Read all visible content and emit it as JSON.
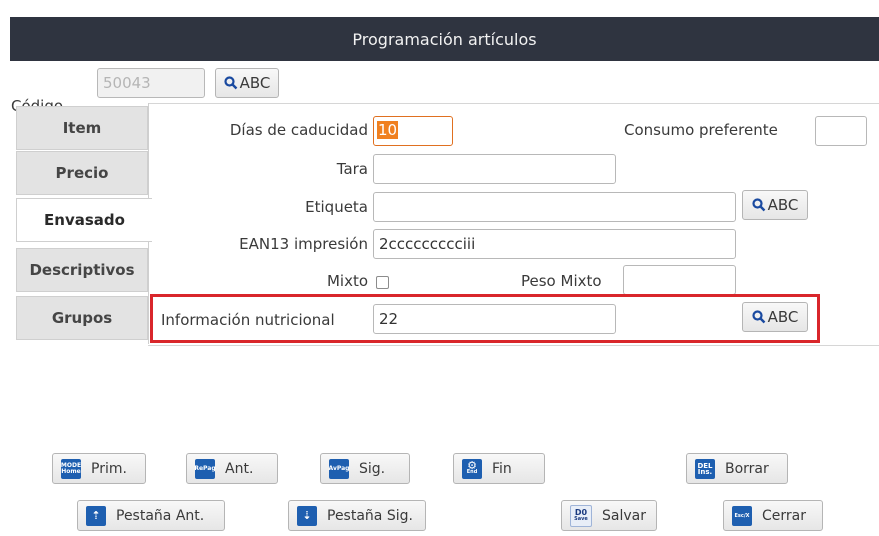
{
  "window": {
    "title": "Programación artículos"
  },
  "codigo": {
    "label": "Código",
    "value": "50043",
    "search_label": "ABC"
  },
  "tabs": [
    {
      "label": "Item"
    },
    {
      "label": "Precio"
    },
    {
      "label": "Envasado"
    },
    {
      "label": "Descriptivos"
    },
    {
      "label": "Grupos"
    }
  ],
  "form": {
    "dias_caducidad": {
      "label": "Días de caducidad",
      "value": "10"
    },
    "consumo_preferente": {
      "label": "Consumo preferente",
      "value": ""
    },
    "tara": {
      "label": "Tara",
      "value": ""
    },
    "etiqueta": {
      "label": "Etiqueta",
      "value": "",
      "search_label": "ABC"
    },
    "ean13": {
      "label": "EAN13 impresión",
      "value": "2ccccccccciii"
    },
    "mixto": {
      "label": "Mixto",
      "checked": false
    },
    "peso_mixto": {
      "label": "Peso Mixto",
      "value": ""
    },
    "info_nutricional": {
      "label": "Información nutricional",
      "value": "22",
      "search_label": "ABC"
    }
  },
  "buttons": {
    "prim": {
      "label": "Prim.",
      "key": "MODE",
      "key2": "Home"
    },
    "ant": {
      "label": "Ant.",
      "key": "RePag"
    },
    "sig": {
      "label": "Sig.",
      "key": "AvPag"
    },
    "fin": {
      "label": "Fin",
      "key": "End"
    },
    "borrar": {
      "label": "Borrar",
      "key": "DEL",
      "key2": "Ins."
    },
    "pestana_ant": {
      "label": "Pestaña Ant."
    },
    "pestana_sig": {
      "label": "Pestaña Sig."
    },
    "salvar": {
      "label": "Salvar",
      "key": "D0",
      "key2": "Save"
    },
    "cerrar": {
      "label": "Cerrar",
      "key": "Esc/X"
    }
  },
  "colors": {
    "titlebar": "#2f3440",
    "highlight": "#d9262b",
    "focus": "#e07020"
  }
}
